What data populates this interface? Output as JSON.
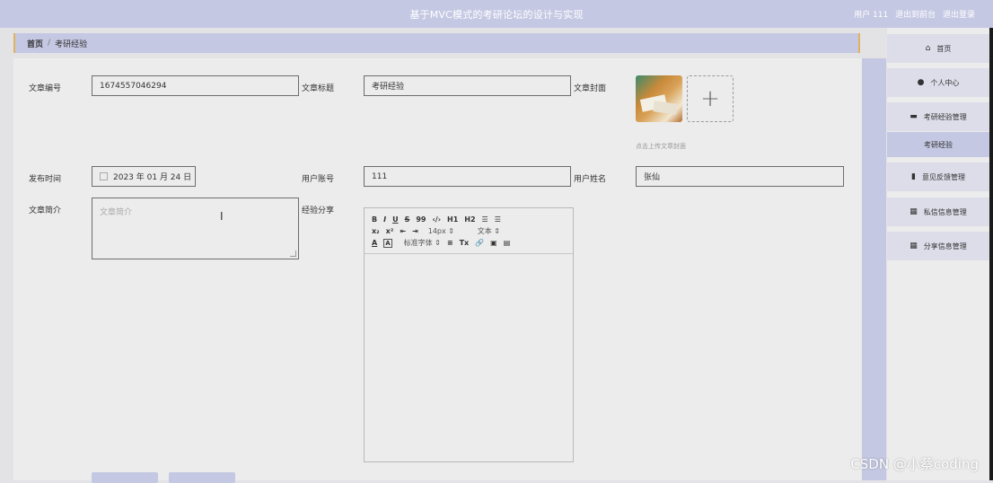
{
  "header": {
    "title": "基于MVC模式的考研论坛的设计与实现",
    "user_label": "用户 111",
    "exit_system": "退出到前台",
    "logout": "退出登录"
  },
  "breadcrumb": {
    "home": "首页",
    "separator": "/",
    "current": "考研经验"
  },
  "form": {
    "article_id_label": "文章编号",
    "article_id_value": "1674557046294",
    "article_title_label": "文章标题",
    "article_title_value": "考研经验",
    "article_cover_label": "文章封面",
    "cover_upload_hint": "点击上传文章封面",
    "publish_time_label": "发布时间",
    "publish_time_value": "2023 年 01 月 24 日",
    "user_account_label": "用户账号",
    "user_account_value": "111",
    "user_name_label": "用户姓名",
    "user_name_value": "张仙",
    "summary_label": "文章简介",
    "summary_placeholder": "文章简介",
    "share_label": "经验分享"
  },
  "editor": {
    "row1": [
      "B",
      "I",
      "U",
      "S",
      "99",
      "‹/›",
      "H1",
      "H2",
      "☰",
      "☰"
    ],
    "row2": [
      "x₂",
      "x²",
      "⇤",
      "⇥"
    ],
    "font_size": "14px",
    "text_type": "文本",
    "font_family": "标准字体",
    "row3_icons": [
      "A",
      "A",
      "≡",
      "Tx",
      "🔗",
      "▣",
      "▤"
    ]
  },
  "sidebar": {
    "items": [
      {
        "label": "首页",
        "icon": "home-icon"
      },
      {
        "label": "个人中心",
        "icon": "user-icon"
      },
      {
        "label": "考研经验管理",
        "icon": "chat-icon"
      },
      {
        "label": "考研经验",
        "icon": ""
      },
      {
        "label": "意见反馈管理",
        "icon": "bar-chart-icon"
      },
      {
        "label": "私信信息管理",
        "icon": "grid-icon"
      },
      {
        "label": "分享信息管理",
        "icon": "grid-icon"
      }
    ]
  },
  "watermark": "CSDN @小蔡coding",
  "colors": {
    "accent": "#c5c8e3",
    "border": "#6d6d6d",
    "highlight": "#e0b25b"
  }
}
